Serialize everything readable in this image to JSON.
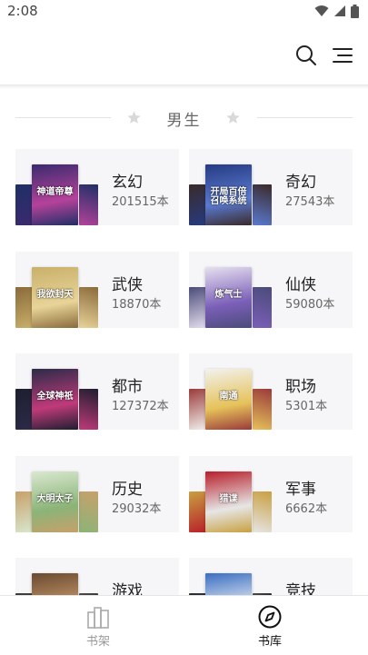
{
  "status_bar": {
    "time": "2:08",
    "icons": [
      "wifi-icon",
      "signal-icon",
      "battery-icon"
    ]
  },
  "header": {
    "icons": [
      "search-icon",
      "menu-icon"
    ]
  },
  "section": {
    "title": "男生"
  },
  "categories": [
    {
      "name": "玄幻",
      "count": "201515本",
      "cover_text": "神道帝尊",
      "colors": [
        "#3b2a6e",
        "#b5429a",
        "#1f2f66"
      ]
    },
    {
      "name": "奇幻",
      "count": "27543本",
      "cover_text": "开局百倍召唤系统",
      "colors": [
        "#263b82",
        "#5a7ad0",
        "#3a2a2a"
      ]
    },
    {
      "name": "武侠",
      "count": "18870本",
      "cover_text": "我欲封天",
      "colors": [
        "#c9b06a",
        "#e8d498",
        "#8a6a3a"
      ]
    },
    {
      "name": "仙侠",
      "count": "59080本",
      "cover_text": "炼气士",
      "colors": [
        "#e6e0f0",
        "#7b5fb8",
        "#4b4b7a"
      ]
    },
    {
      "name": "都市",
      "count": "127372本",
      "cover_text": "全球神祇",
      "colors": [
        "#2b2b48",
        "#c03a7a",
        "#1e1e30"
      ]
    },
    {
      "name": "职场",
      "count": "5301本",
      "cover_text": "南通",
      "colors": [
        "#f2f2ee",
        "#e6c25a",
        "#9a3a3a"
      ]
    },
    {
      "name": "历史",
      "count": "29032本",
      "cover_text": "大明太子",
      "colors": [
        "#d9e8d0",
        "#8bb478",
        "#c8a06a"
      ]
    },
    {
      "name": "军事",
      "count": "6662本",
      "cover_text": "猎谍",
      "colors": [
        "#b81e2a",
        "#e6e6e6",
        "#c8a040"
      ]
    },
    {
      "name": "游戏",
      "count": "",
      "cover_text": "",
      "colors": [
        "#6a4a32",
        "#c89a6a",
        "#3a3a3a"
      ]
    },
    {
      "name": "竞技",
      "count": "",
      "cover_text": "",
      "colors": [
        "#3a6ec0",
        "#e8eef6",
        "#2a2a2a"
      ]
    }
  ],
  "bottom_nav": {
    "items": [
      {
        "label": "书架",
        "icon": "bookshelf-icon",
        "active": false
      },
      {
        "label": "书库",
        "icon": "compass-icon",
        "active": true
      }
    ],
    "active_color": "#111111",
    "inactive_color": "#999999"
  }
}
